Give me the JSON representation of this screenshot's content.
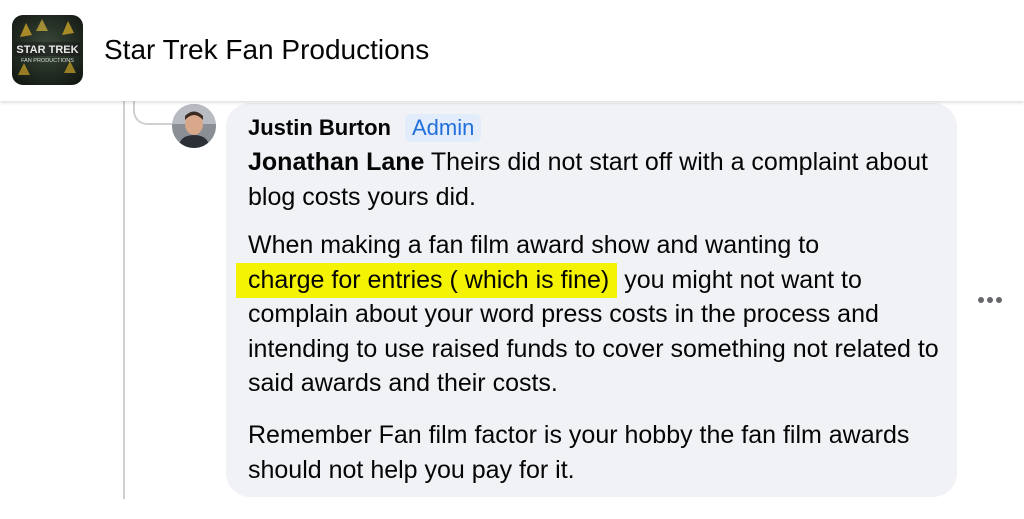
{
  "header": {
    "group_name": "Star Trek Fan Productions",
    "logo_line1": "STAR TREK",
    "logo_line2": "FAN PRODUCTIONS"
  },
  "comment": {
    "author": "Justin Burton",
    "badge": "Admin",
    "mention": "Jonathan Lane",
    "p1_rest": " Theirs did not start off with a complaint about blog costs yours did.",
    "p2_line1": "When making a fan film award show and wanting to ",
    "p2_highlight": "charge for entries ( which is fine)",
    "p2_rest": " you might not want to complain about your word press costs in the process and intending to use raised funds to cover something not related to said awards and their costs.",
    "p3": "Remember Fan film factor is your hobby the fan film awards should not help you pay for it."
  },
  "colors": {
    "highlight": "#f3f303",
    "admin_badge_text": "#216fdb",
    "bubble_bg": "#f0f2f5"
  },
  "icons": {
    "more": "more-horizontal-icon"
  }
}
